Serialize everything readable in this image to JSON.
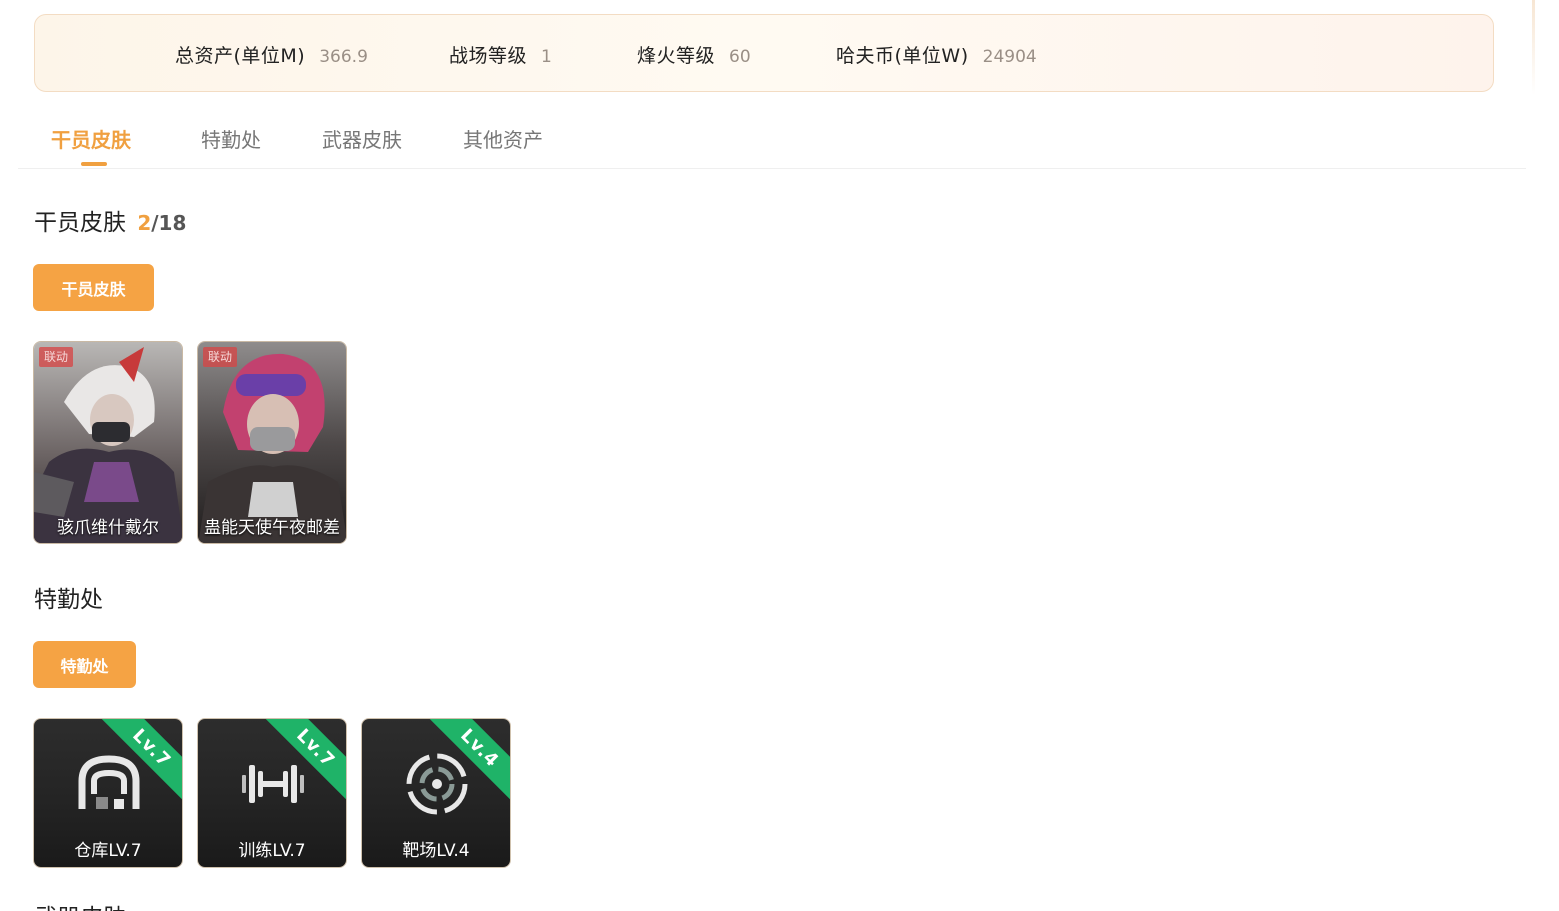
{
  "stats": [
    {
      "label": "总资产(单位M)",
      "value": "366.9"
    },
    {
      "label": "战场等级",
      "value": "1"
    },
    {
      "label": "烽火等级",
      "value": "60"
    },
    {
      "label": "哈夫币(单位W)",
      "value": "24904"
    }
  ],
  "tabs": [
    {
      "label": "干员皮肤",
      "active": true
    },
    {
      "label": "特勤处",
      "active": false
    },
    {
      "label": "武器皮肤",
      "active": false
    },
    {
      "label": "其他资产",
      "active": false
    }
  ],
  "operator_skins": {
    "title": "干员皮肤",
    "owned": "2",
    "total": "/18",
    "filter_label": "干员皮肤",
    "cards": [
      {
        "tag": "联动",
        "name": "骇爪维什戴尔"
      },
      {
        "tag": "联动",
        "name": "蛊能天使午夜邮差"
      }
    ]
  },
  "special_ops": {
    "title": "特勤处",
    "filter_label": "特勤处",
    "facilities": [
      {
        "badge": "Lv.7",
        "label": "仓库LV.7",
        "icon": "warehouse-icon"
      },
      {
        "badge": "Lv.7",
        "label": "训练LV.7",
        "icon": "dumbbell-icon"
      },
      {
        "badge": "Lv.4",
        "label": "靶场LV.4",
        "icon": "target-icon"
      }
    ]
  },
  "weapon_skins": {
    "title": "武器皮肤"
  },
  "colors": {
    "accent": "#f0a040",
    "button": "#f5a344",
    "level_ribbon": "#1fb368",
    "collab_tag": "#d64646"
  }
}
